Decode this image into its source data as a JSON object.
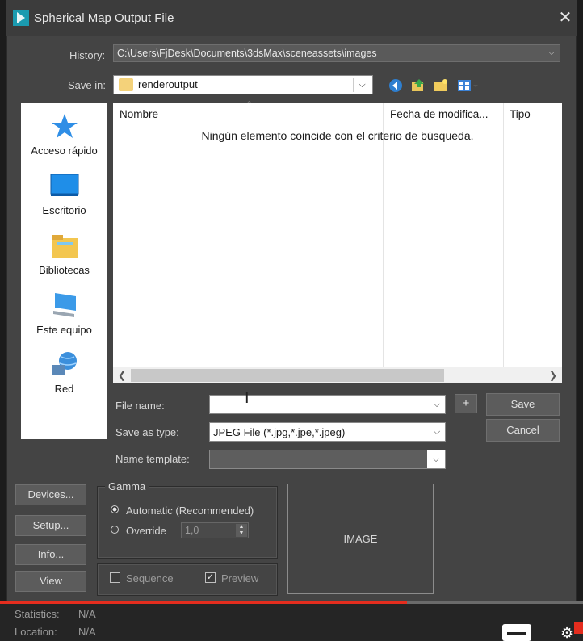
{
  "window": {
    "title": "Spherical Map Output File",
    "close": "✕"
  },
  "history": {
    "label": "History:",
    "value": "C:\\Users\\FjDesk\\Documents\\3dsMax\\sceneassets\\images"
  },
  "save_in": {
    "label": "Save in:",
    "value": "renderoutput"
  },
  "places": [
    {
      "label": "Acceso rápido",
      "icon": "star-icon"
    },
    {
      "label": "Escritorio",
      "icon": "desktop-icon"
    },
    {
      "label": "Bibliotecas",
      "icon": "libraries-icon"
    },
    {
      "label": "Este equipo",
      "icon": "computer-icon"
    },
    {
      "label": "Red",
      "icon": "network-icon"
    }
  ],
  "filelist": {
    "columns": [
      "Nombre",
      "Fecha de modifica...",
      "Tipo"
    ],
    "empty_message": "Ningún elemento coincide con el criterio de búsqueda."
  },
  "form": {
    "file_name_label": "File name:",
    "file_name_value": "",
    "save_as_type_label": "Save as type:",
    "save_as_type_value": "JPEG File (*.jpg,*.jpe,*.jpeg)",
    "name_template_label": "Name template:",
    "plus": "+",
    "save": "Save",
    "cancel": "Cancel"
  },
  "side_buttons": [
    "Devices...",
    "Setup...",
    "Info...",
    "View"
  ],
  "gamma": {
    "title": "Gamma",
    "automatic": "Automatic (Recommended)",
    "override": "Override",
    "override_value": "1,0"
  },
  "sequence": "Sequence",
  "preview": "Preview",
  "image_label": "IMAGE",
  "status": {
    "statistics_label": "Statistics:",
    "statistics_value": "N/A",
    "location_label": "Location:",
    "location_value": "N/A"
  },
  "colors": {
    "video_progress": "#e52d1e",
    "window_bg": "#444444"
  }
}
